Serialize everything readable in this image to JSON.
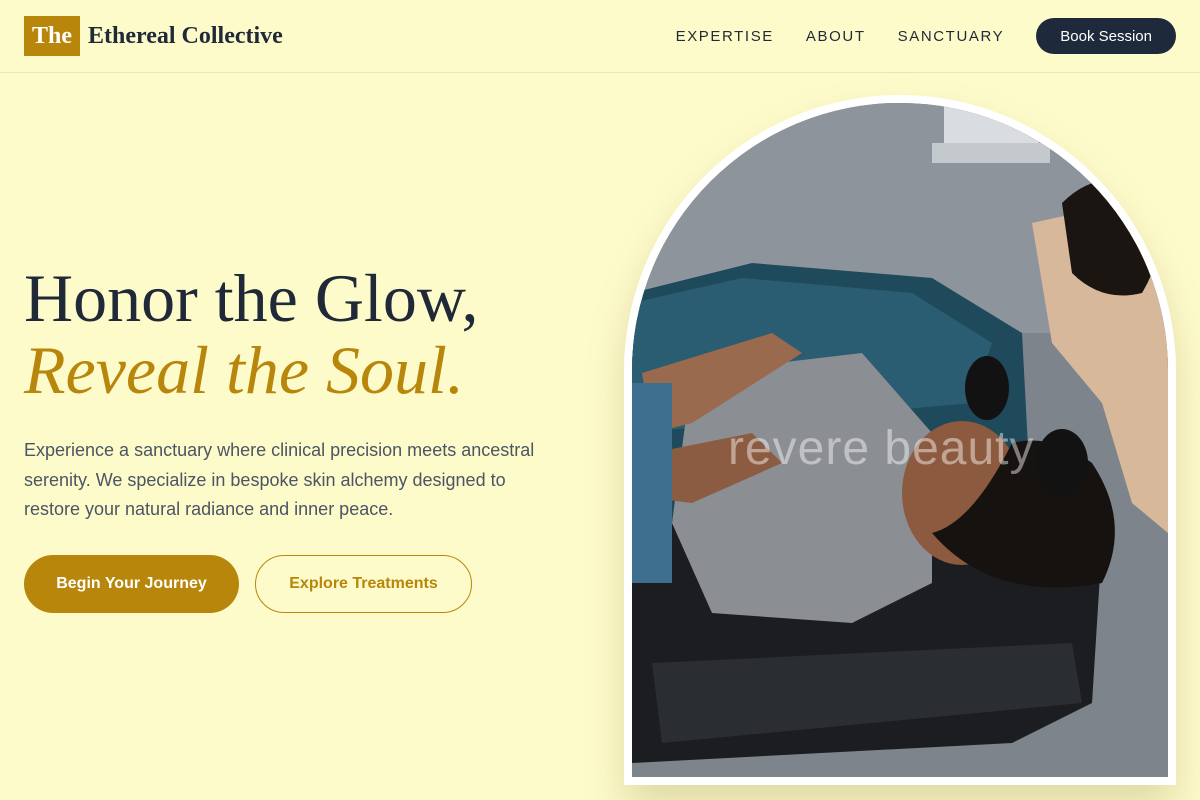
{
  "header": {
    "logo_mark": "The",
    "brand_name": "Ethereal Collective",
    "nav": [
      "EXPERTISE",
      "ABOUT",
      "SANCTUARY"
    ],
    "cta_label": "Book Session"
  },
  "hero": {
    "title_line1": "Honor the Glow,",
    "title_line2": "Reveal the Soul.",
    "description": "Experience a sanctuary where clinical precision meets ancestral serenity. We specialize in bespoke skin alchemy designed to restore your natural radiance and inner peace.",
    "primary_button": "Begin Your Journey",
    "secondary_button": "Explore Treatments"
  },
  "image": {
    "watermark": "revere beauty"
  },
  "colors": {
    "background": "#fefbcb",
    "accent": "#b8860b",
    "dark": "#1e293b"
  }
}
